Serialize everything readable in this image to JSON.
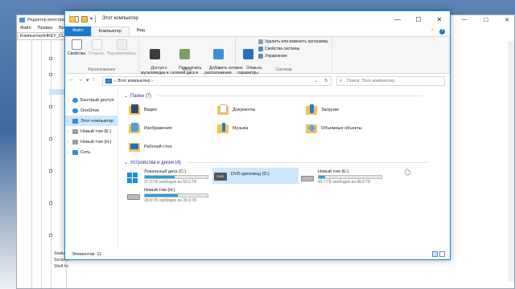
{
  "registry": {
    "title": "Редактор реестра",
    "menu": [
      "Файл",
      "Правка",
      "Вид"
    ],
    "address": "Компьютер\\HKEY_CURR",
    "tree_bottom": [
      "Seatugrtoolsy",
      "Securit...",
      "Shell.Ini"
    ]
  },
  "explorer": {
    "title": "Этот компьютер",
    "tabs": {
      "file": "Файл",
      "computer": "Компьютер",
      "view": "Вид"
    },
    "ribbon": {
      "location": {
        "label": "Расположение",
        "properties": "Свойства",
        "open": "Открыть",
        "rename": "Переименовать"
      },
      "network": {
        "label": "Сеть",
        "media_access": "Доступ к\nмультимедиа ▾",
        "map_drive": "Подключить\nсетевой диск ▾",
        "add_location": "Добавить сетевое\nрасположение"
      },
      "system": {
        "label": "Система",
        "open_settings": "Открыть\nпараметры",
        "uninstall": "Удалить или изменить программу",
        "system_props": "Свойства системы",
        "manage": "Управление"
      }
    },
    "address": {
      "path": "Этот компьютер",
      "separator": "›"
    },
    "search": {
      "placeholder": "Поиск: Этот компьютер"
    },
    "nav": {
      "quick_access": "Быстрый доступ",
      "onedrive": "OneDrive",
      "this_pc": "Этот компьютер",
      "vol_e": "Новый том (E:)",
      "vol_h": "Новый том (H:)",
      "network": "Сеть"
    },
    "folders_header": "Папки (7)",
    "folders": {
      "video": "Видео",
      "documents": "Документы",
      "downloads": "Загрузки",
      "pictures": "Изображения",
      "music": "Музыка",
      "objects3d": "Объемные объекты",
      "desktop": "Рабочий стол"
    },
    "drives_header": "Устройства и диски (4)",
    "drives": {
      "c": {
        "name": "Локальный диск (C:)",
        "free": "27,0 ГБ свободно из 50,5 ГБ",
        "used_fraction": 0.47
      },
      "d": {
        "name": "DVD-дисковод (D:)",
        "dvd_label": "DVD"
      },
      "e": {
        "name": "Новый том (E:)",
        "free": "43,7 ГБ свободно из 48,8 ГБ",
        "used_fraction": 0.1
      },
      "h": {
        "name": "Новый том (H:)",
        "free": "18,8 ГБ свободно из 39,9 ГБ",
        "used_fraction": 0.53
      }
    },
    "status": "Элементов: 11"
  },
  "colors": {
    "accent": "#1979ca",
    "selection": "#cce8ff",
    "folder": "#eec45a"
  }
}
